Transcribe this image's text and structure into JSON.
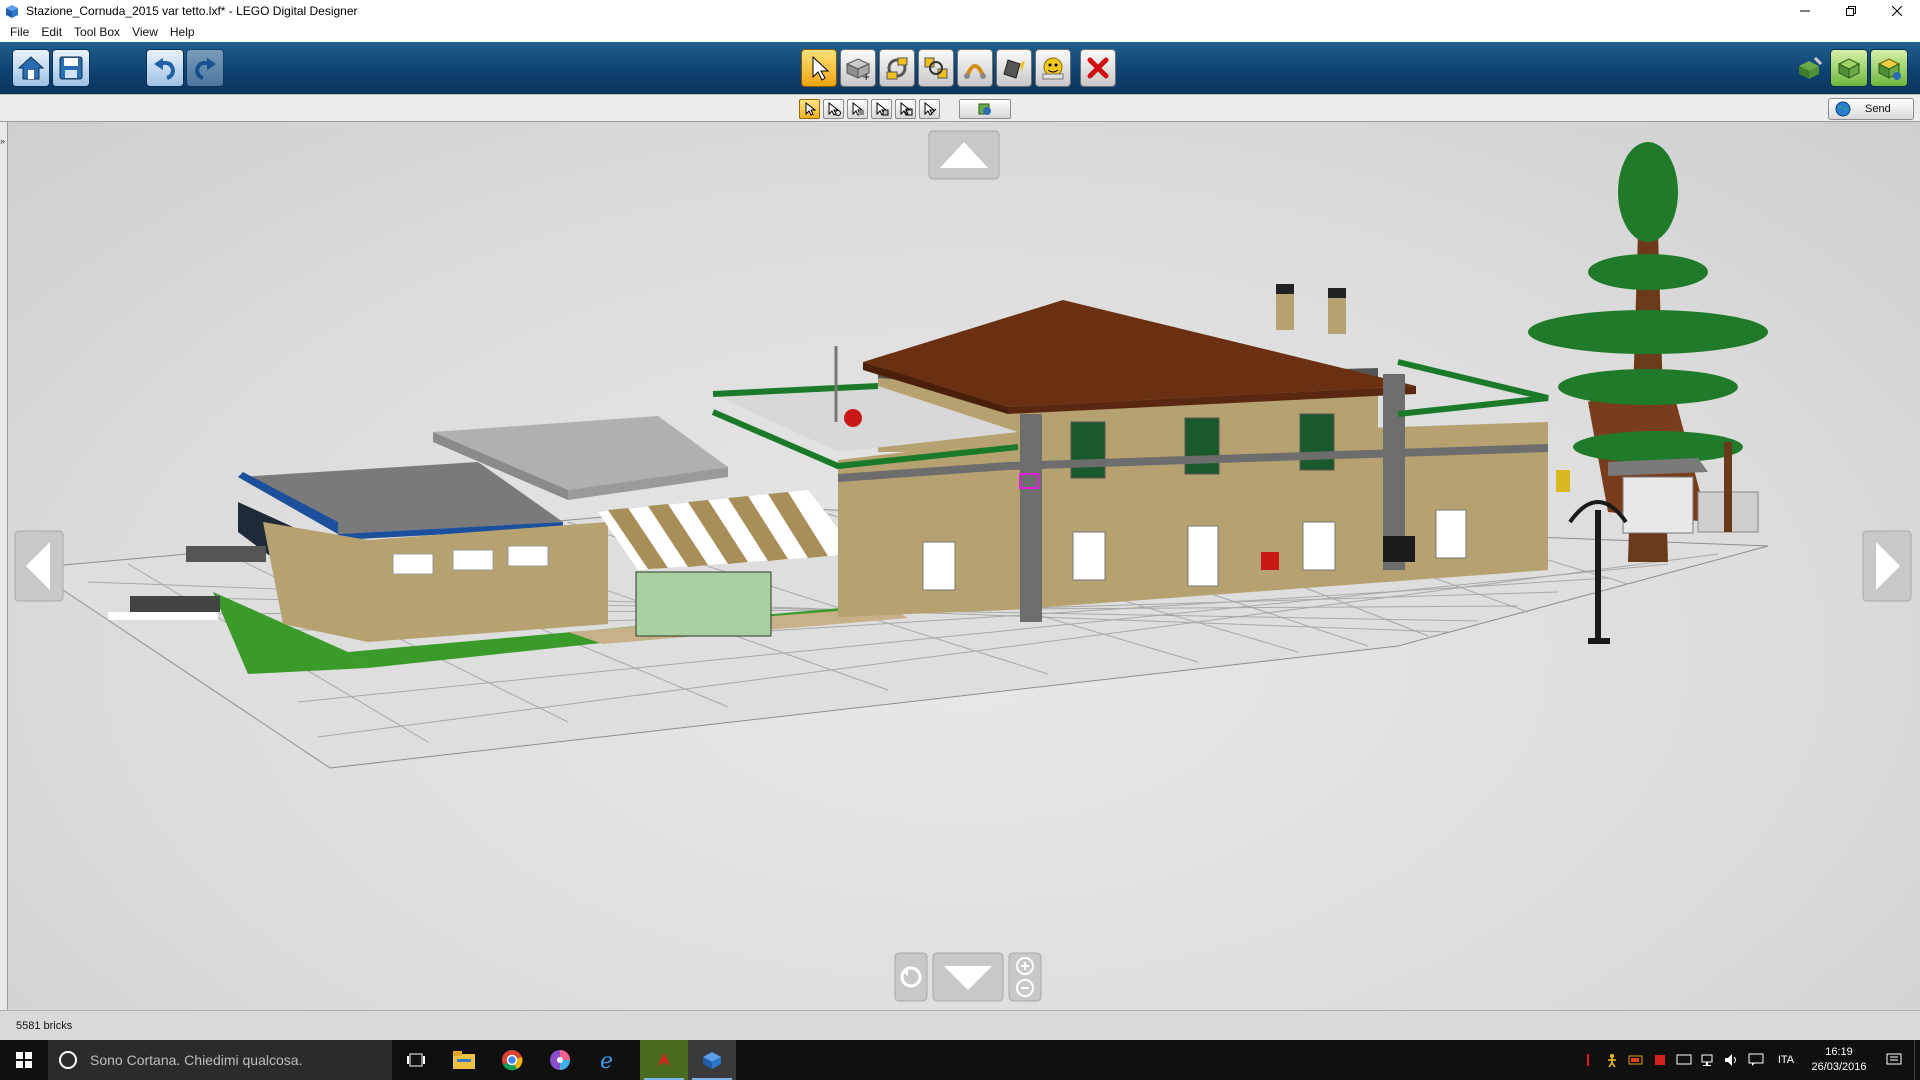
{
  "window": {
    "title": "Stazione_Cornuda_2015 var tetto.lxf* - LEGO Digital Designer"
  },
  "menu": {
    "items": [
      {
        "label": "File"
      },
      {
        "label": "Edit"
      },
      {
        "label": "Tool Box"
      },
      {
        "label": "View"
      },
      {
        "label": "Help"
      }
    ]
  },
  "toolbar": {
    "left_buttons": [
      "home-icon",
      "save-icon",
      "undo-icon",
      "redo-icon"
    ],
    "tools": [
      "select-arrow-icon",
      "clone-brick-icon",
      "hinge-icon",
      "hinge-align-icon",
      "flex-icon",
      "paint-bucket-icon",
      "hide-icon",
      "delete-icon"
    ],
    "active_tool": "select-arrow-icon",
    "right_buttons": [
      "build-mode-icon",
      "view-mode-icon",
      "building-guide-icon"
    ]
  },
  "subtoolbar": {
    "select_modes": [
      "single-select-icon",
      "multi-select-icon",
      "connected-select-icon",
      "same-color-select-icon",
      "same-brick-select-icon",
      "invert-select-icon"
    ],
    "active_mode": "single-select-icon",
    "send_label": "Send"
  },
  "status": {
    "brick_count": "5581 bricks"
  },
  "taskbar": {
    "search_placeholder": "Sono Cortana. Chiedimi qualcosa.",
    "language": "ITA",
    "time": "16:19",
    "date": "26/03/2016"
  },
  "colors": {
    "toolbar_blue": "#0f4170",
    "roof_brown": "#6b3012",
    "wall_tan": "#b6a170",
    "grass_green": "#3a9a2a",
    "accent_orange": "#f0a510"
  }
}
